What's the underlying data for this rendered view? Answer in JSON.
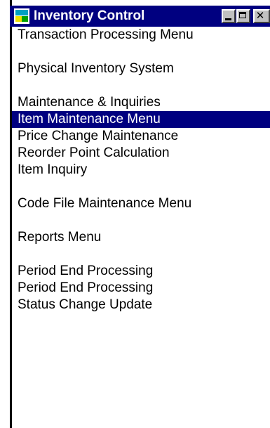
{
  "window": {
    "title": "Inventory Control",
    "icon": "application-window-icon",
    "controls": {
      "minimize_icon": "minimize-icon",
      "maximize_icon": "maximize-icon",
      "close_icon": "close-icon",
      "close_glyph": "✕"
    }
  },
  "colors": {
    "title_bar": "#000080",
    "selection": "#000080",
    "selection_text": "#ffffff",
    "text": "#000000",
    "background": "#ffffff"
  },
  "menu": {
    "items": [
      {
        "label": "Transaction Processing Menu",
        "selected": false
      },
      {
        "label": "Physical Inventory System",
        "selected": false
      },
      {
        "label": "Maintenance & Inquiries",
        "selected": false
      },
      {
        "label": "Item Maintenance Menu",
        "selected": true
      },
      {
        "label": "Price Change Maintenance",
        "selected": false
      },
      {
        "label": "Reorder Point Calculation",
        "selected": false
      },
      {
        "label": "Item Inquiry",
        "selected": false
      },
      {
        "label": "Code File Maintenance Menu",
        "selected": false
      },
      {
        "label": "Reports Menu",
        "selected": false
      },
      {
        "label": "Period End Processing",
        "selected": false
      },
      {
        "label": "Period End Processing",
        "selected": false
      },
      {
        "label": "Status Change Update",
        "selected": false
      }
    ]
  }
}
